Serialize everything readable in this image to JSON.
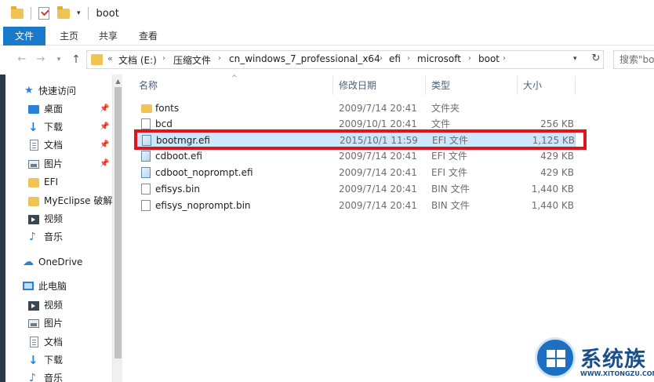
{
  "window": {
    "title": "boot"
  },
  "ribbon": {
    "tabs": [
      {
        "label": "文件"
      },
      {
        "label": "主页"
      },
      {
        "label": "共享"
      },
      {
        "label": "查看"
      }
    ]
  },
  "nav": {
    "back": "←",
    "forward": "→",
    "up": "↑",
    "refresh": "↻"
  },
  "address": {
    "overflow": "«",
    "breadcrumbs": [
      "文档 (E:)",
      "压缩文件",
      "cn_windows_7_professional_x64",
      "efi",
      "microsoft",
      "boot"
    ]
  },
  "search": {
    "placeholder": "搜索\"boot\""
  },
  "sidebar": {
    "quick_access": "快速访问",
    "quick_items": [
      {
        "label": "桌面",
        "icon": "desktop-icon",
        "pinned": true
      },
      {
        "label": "下载",
        "icon": "download-icon",
        "pinned": true
      },
      {
        "label": "文档",
        "icon": "document-icon",
        "pinned": true
      },
      {
        "label": "图片",
        "icon": "picture-icon",
        "pinned": true
      },
      {
        "label": "EFI",
        "icon": "folder-icon",
        "pinned": false
      },
      {
        "label": "MyEclipse 破解",
        "icon": "folder-icon",
        "pinned": false
      },
      {
        "label": "视频",
        "icon": "video-icon",
        "pinned": false
      },
      {
        "label": "音乐",
        "icon": "music-icon",
        "pinned": false
      }
    ],
    "onedrive": "OneDrive",
    "this_pc": "此电脑",
    "pc_items": [
      {
        "label": "视频",
        "icon": "video-icon"
      },
      {
        "label": "图片",
        "icon": "picture-icon"
      },
      {
        "label": "文档",
        "icon": "document-icon"
      },
      {
        "label": "下载",
        "icon": "download-icon"
      },
      {
        "label": "音乐",
        "icon": "music-icon"
      }
    ]
  },
  "filelist": {
    "columns": {
      "name": "名称",
      "modified": "修改日期",
      "type": "类型",
      "size": "大小"
    },
    "rows": [
      {
        "name": "fonts",
        "modified": "2009/7/14 20:41",
        "type": "文件夹",
        "size": "",
        "icon": "folder-icon"
      },
      {
        "name": "bcd",
        "modified": "2009/10/1 20:41",
        "type": "文件",
        "size": "256 KB",
        "icon": "file-icon"
      },
      {
        "name": "bootmgr.efi",
        "modified": "2015/10/1 11:59",
        "type": "EFI 文件",
        "size": "1,125 KB",
        "icon": "efi-file-icon",
        "selected": true
      },
      {
        "name": "cdboot.efi",
        "modified": "2009/7/14 20:41",
        "type": "EFI 文件",
        "size": "429 KB",
        "icon": "efi-file-icon"
      },
      {
        "name": "cdboot_noprompt.efi",
        "modified": "2009/7/14 20:41",
        "type": "EFI 文件",
        "size": "429 KB",
        "icon": "efi-file-icon"
      },
      {
        "name": "efisys.bin",
        "modified": "2009/7/14 20:41",
        "type": "BIN 文件",
        "size": "1,440 KB",
        "icon": "file-icon"
      },
      {
        "name": "efisys_noprompt.bin",
        "modified": "2009/7/14 20:41",
        "type": "BIN 文件",
        "size": "1,440 KB",
        "icon": "file-icon"
      }
    ]
  },
  "watermark": {
    "name": "系统族",
    "url": "WWW.XITONGZU.COM"
  },
  "colors": {
    "accent": "#1979ca",
    "highlight_border": "#e0141c",
    "selection": "#cce8ff"
  }
}
